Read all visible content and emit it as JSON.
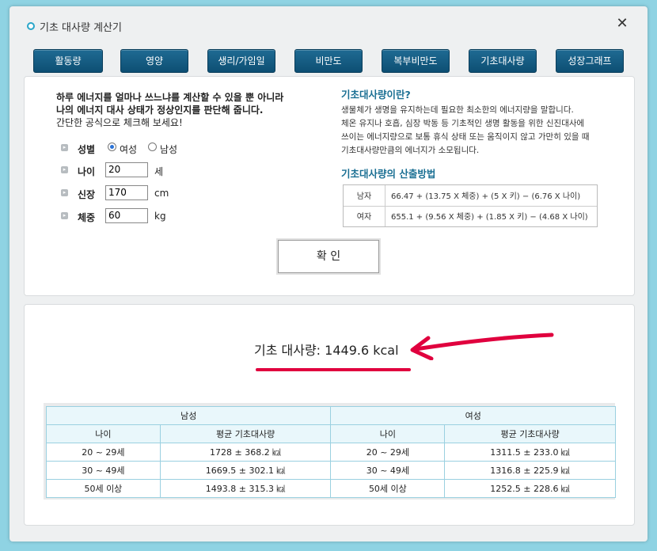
{
  "window": {
    "title": "기초 대사량 계산기"
  },
  "tabs": [
    "활동량",
    "영양",
    "생리/가임일",
    "비만도",
    "복부비만도",
    "기초대사량",
    "성장그래프"
  ],
  "form": {
    "intro_line1": "하루 에너지를 얼마나 쓰느냐를 계산할 수 있을 뿐 아니라",
    "intro_line2": "나의 에너지 대사 상태가 정상인지를 판단해 줍니다.",
    "intro_line3": "간단한 공식으로 체크해 보세요!",
    "sex_label": "성별",
    "sex_female": "여성",
    "sex_male": "남성",
    "sex_selected": "여성",
    "age_label": "나이",
    "age_value": "20",
    "age_unit": "세",
    "height_label": "신장",
    "height_value": "170",
    "height_unit": "cm",
    "weight_label": "체중",
    "weight_value": "60",
    "weight_unit": "kg",
    "confirm_label": "확 인"
  },
  "info": {
    "what_title": "기초대사량이란?",
    "desc_lines": [
      "생물체가 생명을 유지하는데 필요한 최소한의 에너지량을 말합니다.",
      "체온 유지나 호흡, 심장 박동 등 기초적인 생명 활동을 위한 신진대사에",
      "쓰이는 에너지량으로 보통 휴식 상태 또는 움직이지 않고 가만히 있을 때",
      "기초대사량만큼의 에너지가 소모됩니다."
    ],
    "method_title": "기초대사량의 산출방법",
    "formulas": [
      {
        "sex": "남자",
        "expr": "66.47 + (13.75 X 체중) + (5 X 키) − (6.76 X 나이)"
      },
      {
        "sex": "여자",
        "expr": "655.1 + (9.56 X 체중) + (1.85 X 키) − (4.68 X 나이)"
      }
    ]
  },
  "result": {
    "text": "기초 대사량: 1449.6 kcal"
  },
  "stats": {
    "male_header": "남성",
    "female_header": "여성",
    "age_col": "나이",
    "avg_col": "평균 기초대사량",
    "rows": [
      {
        "m_age": "20 ~ 29세",
        "m_avg": "1728 ± 368.2 ㎉",
        "f_age": "20 ~ 29세",
        "f_avg": "1311.5 ± 233.0 ㎉"
      },
      {
        "m_age": "30 ~ 49세",
        "m_avg": "1669.5 ± 302.1 ㎉",
        "f_age": "30 ~ 49세",
        "f_avg": "1316.8 ± 225.9 ㎉"
      },
      {
        "m_age": "50세 이상",
        "m_avg": "1493.8 ± 315.3 ㎉",
        "f_age": "50세 이상",
        "f_avg": "1252.5 ± 228.6 ㎉"
      }
    ]
  },
  "colors": {
    "tab_bg": "#0d4f73",
    "accent": "#1a6f93",
    "highlight": "#e0003e",
    "page_bg": "#8fd3e3"
  }
}
